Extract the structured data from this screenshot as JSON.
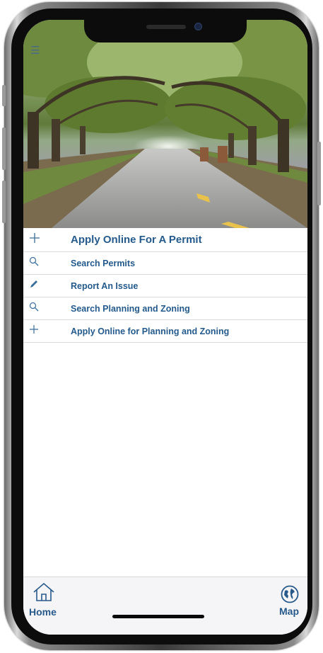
{
  "menu": {
    "items": [
      {
        "label": "Apply Online For A Permit",
        "icon": "plus-icon"
      },
      {
        "label": "Search Permits",
        "icon": "search-icon"
      },
      {
        "label": "Report An Issue",
        "icon": "pencil-icon"
      },
      {
        "label": "Search Planning and Zoning",
        "icon": "search-icon"
      },
      {
        "label": "Apply Online for Planning and Zoning",
        "icon": "plus-icon"
      }
    ]
  },
  "tabbar": {
    "home_label": "Home",
    "map_label": "Map"
  },
  "colors": {
    "accent": "#245a8c",
    "divider": "#dcdcdc",
    "tabbar_bg": "#f5f5f7"
  }
}
